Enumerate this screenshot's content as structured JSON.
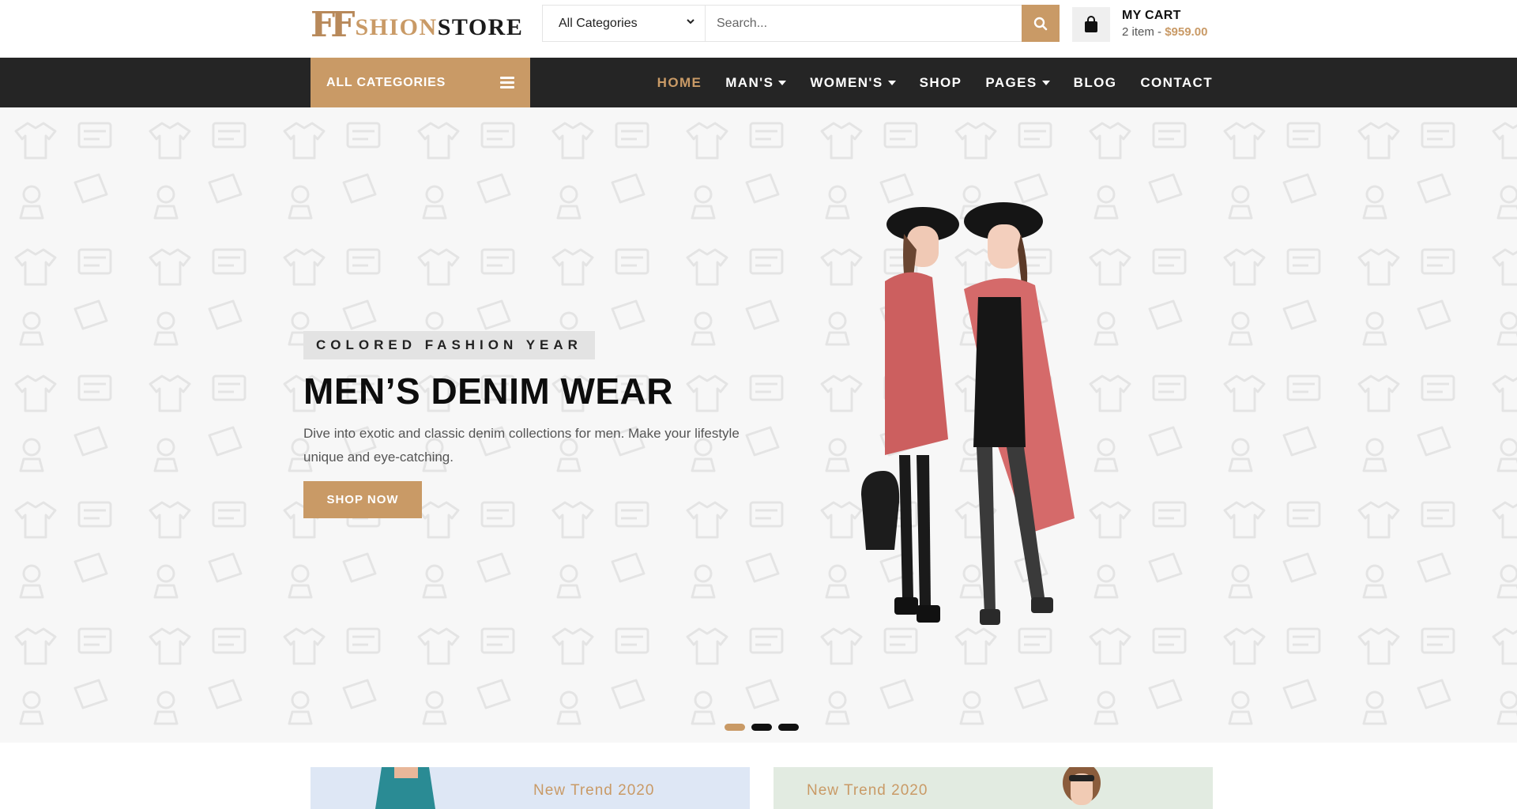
{
  "brand": {
    "mark": "FF",
    "name_part1": "SHION",
    "name_part2": "STORE"
  },
  "search": {
    "category_selected": "All Categories",
    "placeholder": "Search..."
  },
  "cart": {
    "title": "MY CART",
    "summary": "2 item - ",
    "total": "$959.00"
  },
  "nav": {
    "all_categories": "ALL CATEGORIES",
    "items": [
      {
        "label": "HOME",
        "active": true,
        "dropdown": false
      },
      {
        "label": "MAN'S",
        "active": false,
        "dropdown": true
      },
      {
        "label": "WOMEN'S",
        "active": false,
        "dropdown": true
      },
      {
        "label": "SHOP",
        "active": false,
        "dropdown": false
      },
      {
        "label": "PAGES",
        "active": false,
        "dropdown": true
      },
      {
        "label": "BLOG",
        "active": false,
        "dropdown": false
      },
      {
        "label": "CONTACT",
        "active": false,
        "dropdown": false
      }
    ]
  },
  "hero": {
    "tag": "COLORED FASHION YEAR",
    "title": "MEN’S DENIM WEAR",
    "description": "Dive into exotic and classic denim collections for men. Make your lifestyle unique and eye-catching.",
    "button": "SHOP NOW",
    "slides_total": 3,
    "slide_active": 1
  },
  "banners": [
    {
      "label": "New Trend 2020"
    },
    {
      "label": "New Trend 2020"
    }
  ],
  "colors": {
    "accent": "#c99a66",
    "nav_bg": "#252525",
    "hero_bg": "#f7f7f7"
  }
}
